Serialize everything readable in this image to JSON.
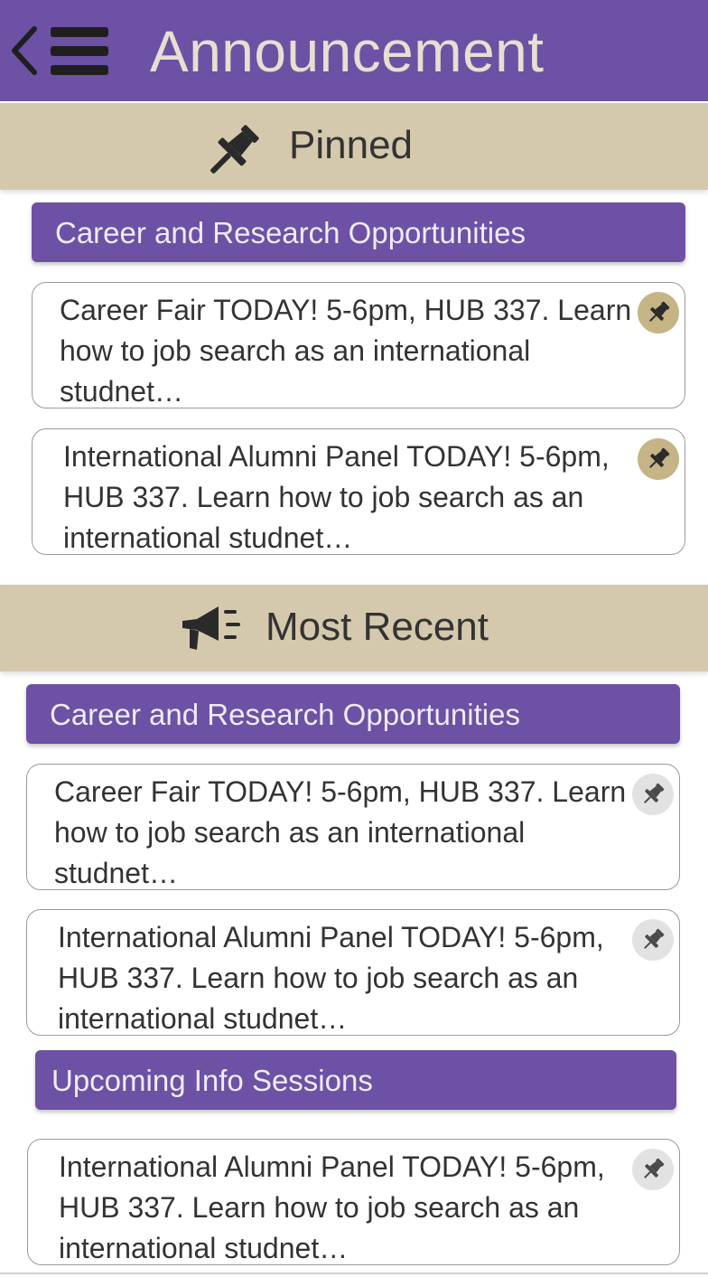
{
  "header": {
    "title": "Announcement",
    "back_icon": "chevron-left-icon",
    "menu_icon": "hamburger-menu-icon",
    "bg_color": "#6d51a4",
    "title_color": "#e7dfd0"
  },
  "pinned": {
    "title": "Pinned",
    "icon": "pushpin-icon",
    "groups": [
      {
        "category": "Career and Research Opportunities",
        "items": [
          {
            "text": "Career Fair TODAY! 5-6pm, HUB 337. Learn how to job search as an international studnet…",
            "pinned": true
          },
          {
            "text": "International Alumni Panel TODAY! 5-6pm, HUB 337. Learn how to job search as an international studnet…",
            "pinned": true
          }
        ]
      }
    ]
  },
  "recent": {
    "title": "Most Recent",
    "icon": "megaphone-icon",
    "groups": [
      {
        "category": "Career and Research Opportunities",
        "items": [
          {
            "text": "Career Fair TODAY! 5-6pm, HUB 337. Learn how to job search as an international studnet…",
            "pinned": false
          },
          {
            "text": "International Alumni Panel TODAY! 5-6pm, HUB 337. Learn how to job search as an international studnet…",
            "pinned": false
          }
        ]
      },
      {
        "category": "Upcoming Info Sessions",
        "items": [
          {
            "text": "International Alumni Panel TODAY! 5-6pm, HUB 337. Learn how to job search as an international studnet…",
            "pinned": false
          }
        ]
      }
    ]
  },
  "colors": {
    "accent_purple": "#6d51a4",
    "section_tan": "#d5c9ad",
    "pin_active": "#c4b486",
    "pin_inactive": "#e2e2e2"
  }
}
